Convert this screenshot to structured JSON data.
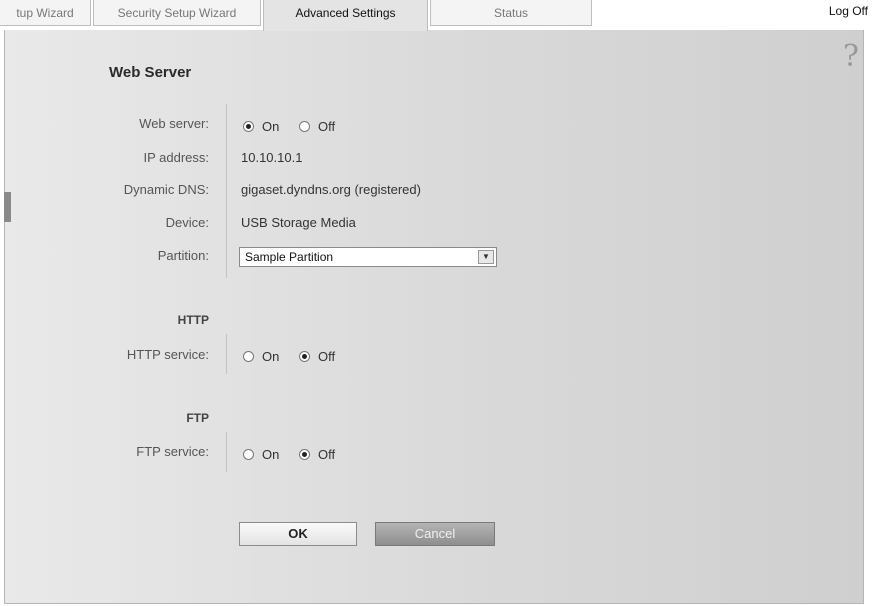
{
  "tabs": [
    {
      "label": "tup Wizard",
      "active": false
    },
    {
      "label": "Security Setup Wizard",
      "active": false
    },
    {
      "label": "Advanced Settings",
      "active": true
    },
    {
      "label": "Status",
      "active": false
    }
  ],
  "header": {
    "log_off": "Log Off",
    "help_icon": "?"
  },
  "section": {
    "title": "Web Server"
  },
  "fields": {
    "web_server": {
      "label": "Web server:",
      "options": [
        "On",
        "Off"
      ],
      "selected": "On"
    },
    "ip_address": {
      "label": "IP address:",
      "value": "10.10.10.1"
    },
    "dynamic_dns": {
      "label": "Dynamic DNS:",
      "value": "gigaset.dyndns.org (registered)"
    },
    "device": {
      "label": "Device:",
      "value": "USB Storage Media"
    },
    "partition": {
      "label": "Partition:",
      "value": "Sample Partition"
    }
  },
  "http": {
    "heading": "HTTP",
    "label": "HTTP service:",
    "options": [
      "On",
      "Off"
    ],
    "selected": "Off"
  },
  "ftp": {
    "heading": "FTP",
    "label": "FTP service:",
    "options": [
      "On",
      "Off"
    ],
    "selected": "Off"
  },
  "buttons": {
    "ok": "OK",
    "cancel": "Cancel"
  }
}
